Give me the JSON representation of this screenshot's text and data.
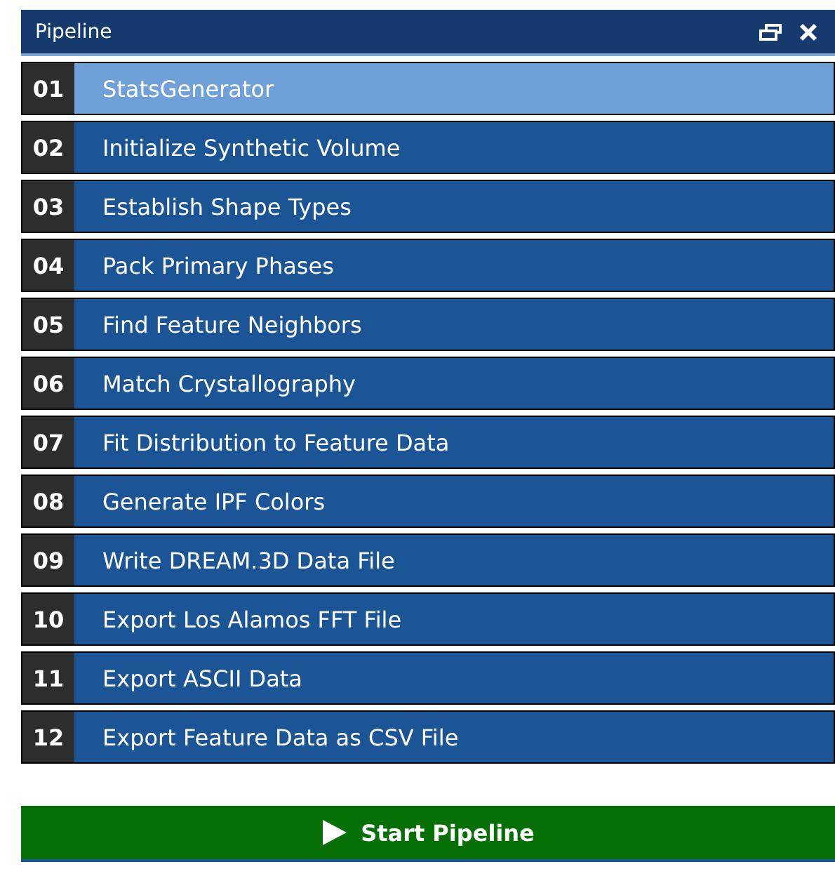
{
  "panel": {
    "title": "Pipeline"
  },
  "filters": [
    {
      "number": "01",
      "name": "StatsGenerator",
      "selected": true
    },
    {
      "number": "02",
      "name": "Initialize Synthetic Volume",
      "selected": false
    },
    {
      "number": "03",
      "name": "Establish Shape Types",
      "selected": false
    },
    {
      "number": "04",
      "name": "Pack Primary Phases",
      "selected": false
    },
    {
      "number": "05",
      "name": "Find Feature Neighbors",
      "selected": false
    },
    {
      "number": "06",
      "name": "Match Crystallography",
      "selected": false
    },
    {
      "number": "07",
      "name": "Fit Distribution to Feature Data",
      "selected": false
    },
    {
      "number": "08",
      "name": "Generate IPF Colors",
      "selected": false
    },
    {
      "number": "09",
      "name": "Write DREAM.3D Data File",
      "selected": false
    },
    {
      "number": "10",
      "name": "Export Los Alamos FFT File",
      "selected": false
    },
    {
      "number": "11",
      "name": "Export ASCII Data",
      "selected": false
    },
    {
      "number": "12",
      "name": "Export Feature Data as CSV File",
      "selected": false
    }
  ],
  "start_button": {
    "label": "Start Pipeline"
  }
}
